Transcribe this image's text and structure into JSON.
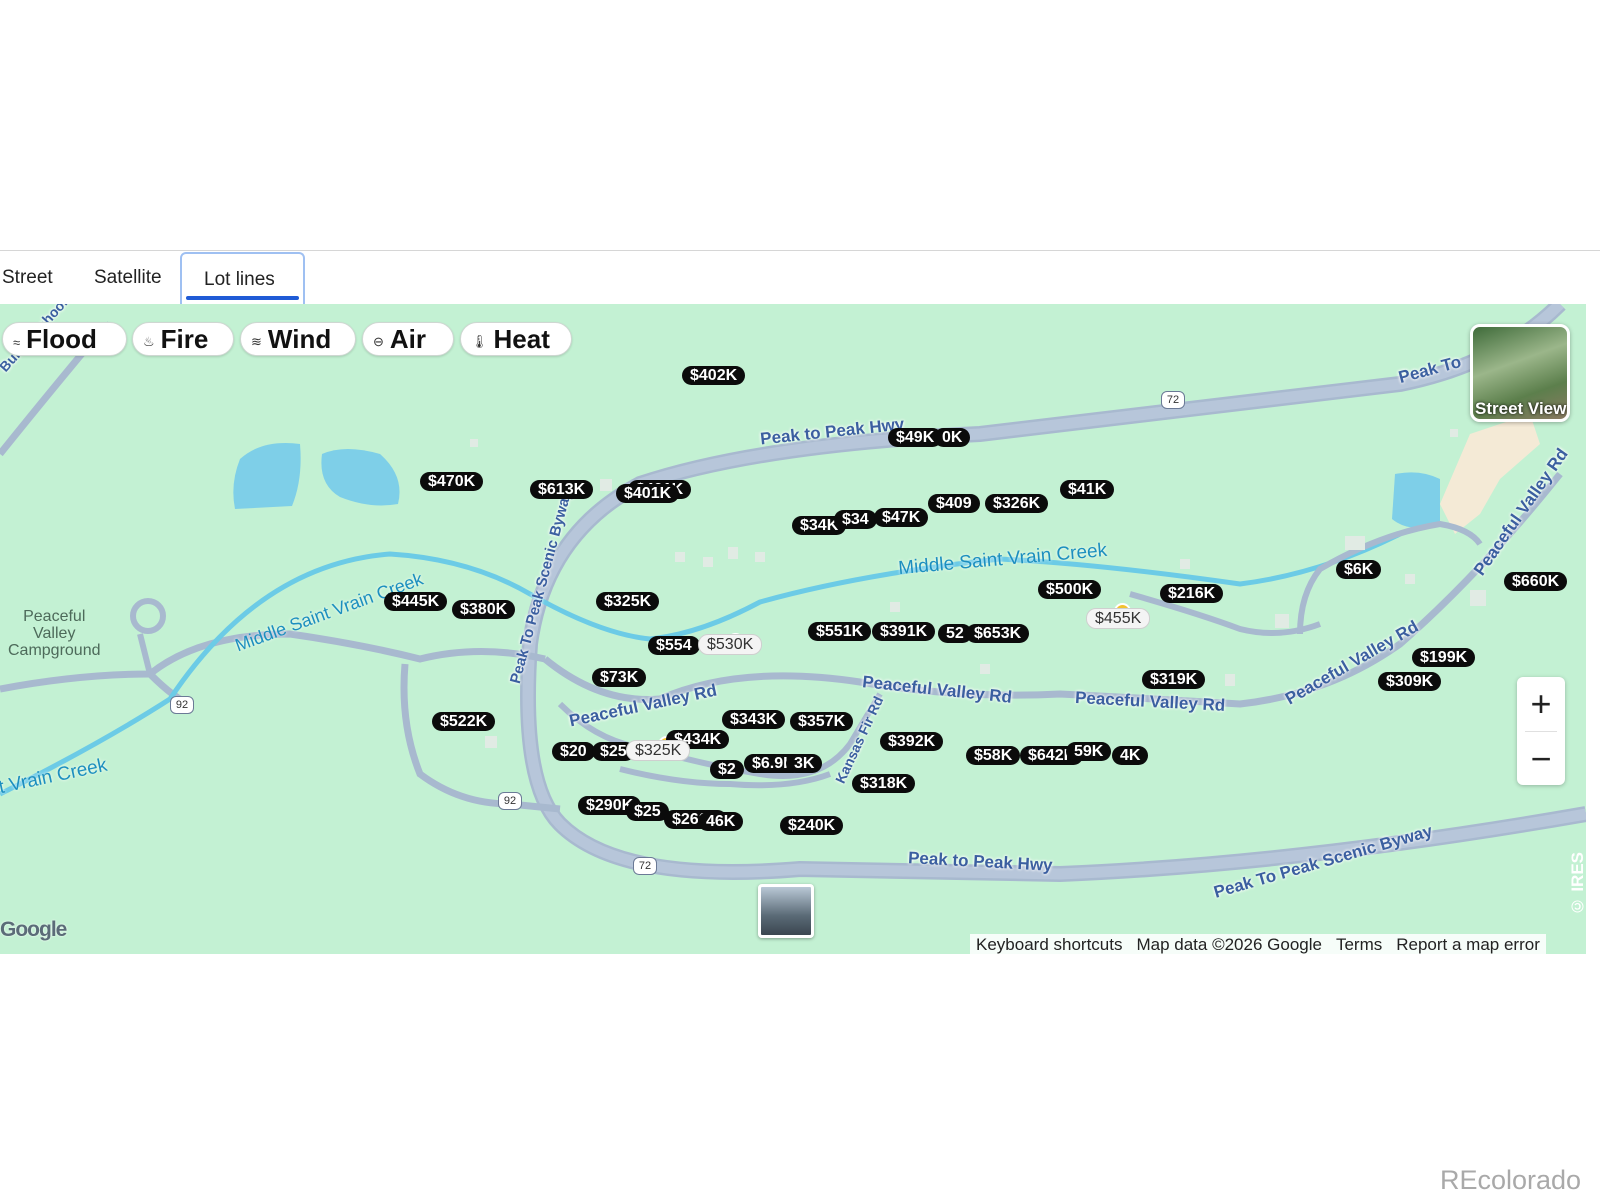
{
  "view_tabs": [
    {
      "label": "Street",
      "active": false
    },
    {
      "label": "Satellite",
      "active": false
    },
    {
      "label": "Lot lines",
      "active": true
    }
  ],
  "hazard_buttons": [
    {
      "label": "Flood",
      "icon": "waves-icon"
    },
    {
      "label": "Fire",
      "icon": "flame-icon"
    },
    {
      "label": "Wind",
      "icon": "wind-icon"
    },
    {
      "label": "Air",
      "icon": "air-icon"
    },
    {
      "label": "Heat",
      "icon": "thermometer-icon"
    }
  ],
  "street_view_label": "Street View",
  "map_labels": {
    "bunce_school_rd": "Bunce School Rd",
    "peak_to_peak_hwy_top": "Peak to Peak Hwy",
    "peak_to_peak_hwy_bottom": "Peak to Peak Hwy",
    "peak_to_peak_byway_left": "Peak To Peak Scenic Byway",
    "peak_to_peak_byway_bottom": "Peak To Peak Scenic Byway",
    "peak_to_top_right": "Peak To",
    "creek_left": "Middle Saint Vrain Creek",
    "creek_center": "Middle Saint Vrain Creek",
    "creek_bottom_left": "t Vrain Creek",
    "peaceful_valley_rd_1": "Peaceful Valley Rd",
    "peaceful_valley_rd_2": "Peaceful Valley Rd",
    "peaceful_valley_rd_3": "Peaceful Valley Rd",
    "peaceful_valley_rd_4": "Peaceful Valley Rd",
    "peaceful_valley_rd_5": "Peaceful Valley Rd",
    "kansas_fir_rd": "Kansas Fir Rd",
    "campground": "Peaceful\nValley\nCampground"
  },
  "route_shields": [
    "72",
    "72",
    "92",
    "92"
  ],
  "price_pins": [
    {
      "label": "$402K",
      "style": "dark"
    },
    {
      "label": "$49K",
      "style": "dark"
    },
    {
      "label": "0K",
      "style": "dark"
    },
    {
      "label": "$470K",
      "style": "dark"
    },
    {
      "label": "$613K",
      "style": "dark"
    },
    {
      "label": "$401K",
      "style": "dark"
    },
    {
      "label": "$401K",
      "style": "dark"
    },
    {
      "label": "$409",
      "style": "dark"
    },
    {
      "label": "$326K",
      "style": "dark"
    },
    {
      "label": "$41K",
      "style": "dark"
    },
    {
      "label": "$34K",
      "style": "dark"
    },
    {
      "label": "$34",
      "style": "dark"
    },
    {
      "label": "$47K",
      "style": "dark"
    },
    {
      "label": "$445K",
      "style": "dark"
    },
    {
      "label": "$380K",
      "style": "dark"
    },
    {
      "label": "$325K",
      "style": "dark"
    },
    {
      "label": "$500K",
      "style": "dark"
    },
    {
      "label": "$216K",
      "style": "dark"
    },
    {
      "label": "$6K",
      "style": "dark"
    },
    {
      "label": "$660K",
      "style": "dark"
    },
    {
      "label": "$455K",
      "style": "light"
    },
    {
      "label": "$554",
      "style": "dark"
    },
    {
      "label": "$530K",
      "style": "light"
    },
    {
      "label": "$551K",
      "style": "dark"
    },
    {
      "label": "$391K",
      "style": "dark"
    },
    {
      "label": "52",
      "style": "dark"
    },
    {
      "label": "$653K",
      "style": "dark"
    },
    {
      "label": "$73K",
      "style": "dark"
    },
    {
      "label": "$319K",
      "style": "dark"
    },
    {
      "label": "$199K",
      "style": "dark"
    },
    {
      "label": "$309K",
      "style": "dark"
    },
    {
      "label": "$522K",
      "style": "dark"
    },
    {
      "label": "$343K",
      "style": "dark"
    },
    {
      "label": "$357K",
      "style": "dark"
    },
    {
      "label": "$434K",
      "style": "dark"
    },
    {
      "label": "$392K",
      "style": "dark"
    },
    {
      "label": "$20",
      "style": "dark"
    },
    {
      "label": "$25",
      "style": "dark"
    },
    {
      "label": "$325K",
      "style": "light"
    },
    {
      "label": "$58K",
      "style": "dark"
    },
    {
      "label": "$642K",
      "style": "dark"
    },
    {
      "label": "59K",
      "style": "dark"
    },
    {
      "label": "4K",
      "style": "dark"
    },
    {
      "label": "$2",
      "style": "dark"
    },
    {
      "label": "$6.9K",
      "style": "dark"
    },
    {
      "label": "3K",
      "style": "dark"
    },
    {
      "label": "$318K",
      "style": "dark"
    },
    {
      "label": "$290K",
      "style": "dark"
    },
    {
      "label": "$25",
      "style": "dark"
    },
    {
      "label": "$260K",
      "style": "dark"
    },
    {
      "label": "46K",
      "style": "dark"
    },
    {
      "label": "$240K",
      "style": "dark"
    }
  ],
  "zoom": {
    "in": "+",
    "out": "−"
  },
  "attribution": {
    "shortcuts": "Keyboard shortcuts",
    "map_data": "Map data ©2026 Google",
    "terms": "Terms",
    "report": "Report a map error"
  },
  "google_logo": "Google",
  "ires": "© IRES",
  "brand": "REcolorado",
  "colors": {
    "map_bg": "#c3f1d3",
    "road": "#a8b9cf",
    "water": "#7ecfe8",
    "pin": "#0b0b0b",
    "active_tab": "#1f5bd6"
  }
}
